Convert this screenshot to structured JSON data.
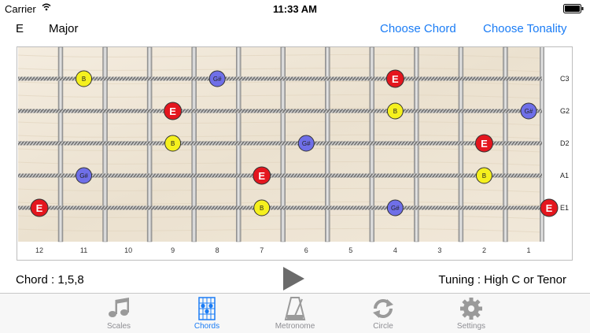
{
  "status_bar": {
    "carrier": "Carrier",
    "time": "11:33 AM",
    "battery": ""
  },
  "header": {
    "key": "E",
    "mode": "Major",
    "choose_chord": "Choose Chord",
    "choose_tonality": "Choose Tonality"
  },
  "fretboard": {
    "fret_numbers": [
      "12",
      "11",
      "10",
      "9",
      "8",
      "7",
      "6",
      "5",
      "4",
      "3",
      "2",
      "1"
    ],
    "strings": [
      {
        "name": "C3",
        "notes": [
          {
            "fret": 11,
            "label": "B",
            "role": "fifth"
          },
          {
            "fret": 8,
            "label": "G#",
            "role": "third"
          },
          {
            "fret": 4,
            "label": "E",
            "role": "root"
          }
        ]
      },
      {
        "name": "G2",
        "notes": [
          {
            "fret": 9,
            "label": "E",
            "role": "root"
          },
          {
            "fret": 4,
            "label": "B",
            "role": "fifth"
          },
          {
            "fret": 1,
            "label": "G#",
            "role": "third"
          }
        ]
      },
      {
        "name": "D2",
        "notes": [
          {
            "fret": 9,
            "label": "B",
            "role": "fifth"
          },
          {
            "fret": 6,
            "label": "G#",
            "role": "third"
          },
          {
            "fret": 2,
            "label": "E",
            "role": "root"
          }
        ]
      },
      {
        "name": "A1",
        "notes": [
          {
            "fret": 11,
            "label": "G#",
            "role": "third"
          },
          {
            "fret": 7,
            "label": "E",
            "role": "root"
          },
          {
            "fret": 2,
            "label": "B",
            "role": "fifth"
          }
        ]
      },
      {
        "name": "E1",
        "notes": [
          {
            "fret": 12,
            "label": "E",
            "role": "root"
          },
          {
            "fret": 7,
            "label": "B",
            "role": "fifth"
          },
          {
            "fret": 4,
            "label": "G#",
            "role": "third"
          },
          {
            "fret": 0,
            "label": "E",
            "role": "root"
          }
        ]
      }
    ]
  },
  "colors": {
    "root": "#e4161e",
    "third": "#6f6fe8",
    "fifth": "#f5f01e",
    "accent": "#1a7cf5",
    "wood": "#efe6d6"
  },
  "footer": {
    "chord_formula": "Chord : 1,5,8",
    "tuning": "Tuning : High C or Tenor"
  },
  "tabs": [
    {
      "label": "Scales",
      "icon": "music-note-icon",
      "active": false
    },
    {
      "label": "Chords",
      "icon": "chord-diagram-icon",
      "active": true
    },
    {
      "label": "Metronome",
      "icon": "metronome-icon",
      "active": false
    },
    {
      "label": "Circle",
      "icon": "circle-arrows-icon",
      "active": false
    },
    {
      "label": "Settings",
      "icon": "gear-icon",
      "active": false
    }
  ]
}
